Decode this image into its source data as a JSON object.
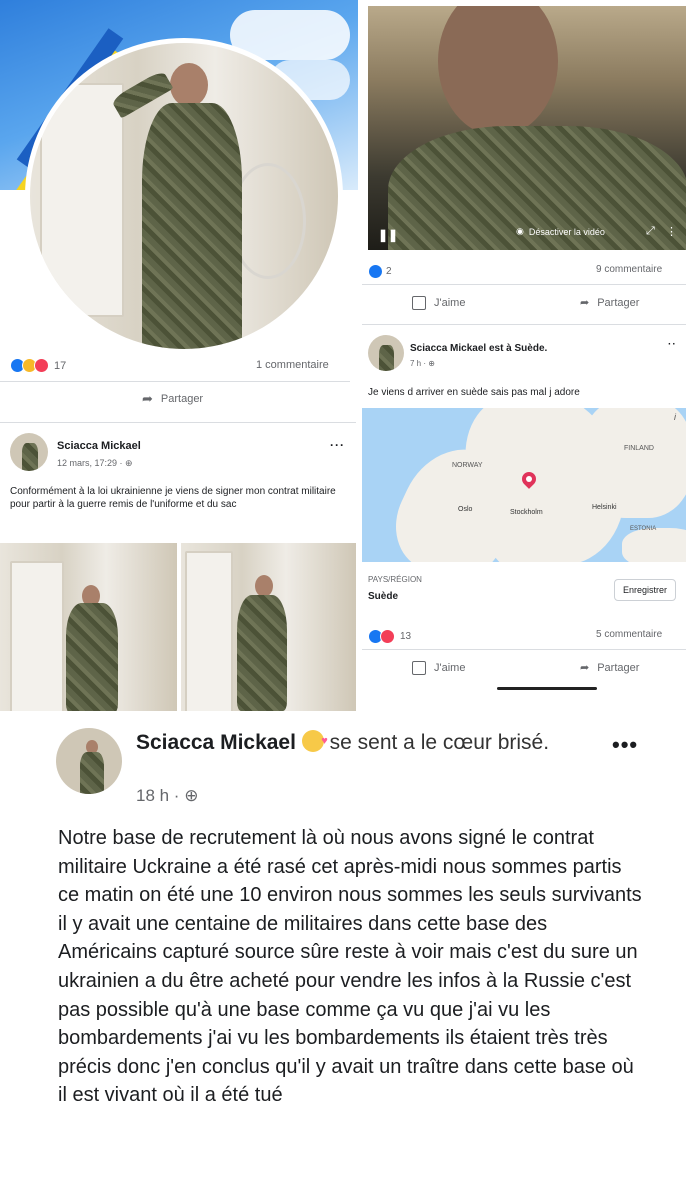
{
  "post_profile": {
    "reactions_count": "17",
    "comments": "1 commentaire",
    "share_label": "Partager"
  },
  "post_video": {
    "reactions_count": "2",
    "comments": "9 commentaire",
    "video_control": "Désactiver la vidéo",
    "like_label": "J'aime",
    "share_label": "Partager"
  },
  "post_contract": {
    "author": "Sciacca Mickael",
    "time": "12 mars, 17:29 · ",
    "text": "Conformément à la loi ukrainienne je viens de signer mon contrat militaire pour partir à la guerre remis de l'uniforme et du sac"
  },
  "post_sweden": {
    "author_line": "Sciacca Mickael est à Suède.",
    "time": "7 h · ",
    "text": "Je viens d arriver en suède sais pas mal j adore",
    "map_labels": [
      "FINLAND",
      "NORWAY",
      "Oslo",
      "Stockholm",
      "Helsinki",
      "ESTONIA"
    ],
    "place_type": "PAYS/RÉGION",
    "place_name": "Suède",
    "save_button": "Enregistrer",
    "reactions_count": "13",
    "comments": "5 commentaire",
    "like_label": "J'aime",
    "share_label": "Partager"
  },
  "post_main": {
    "author": "Sciacca Mickael",
    "feeling": "se sent a le cœur brisé.",
    "time": "18 h · ",
    "text": "Notre base de recrutement là où nous avons signé le contrat militaire Uckraine a été rasé cet après-midi nous sommes partis ce matin on été une 10 environ nous sommes les seuls survivants il y avait une centaine de militaires dans cette base des Américains capturé source sûre reste à voir mais c'est du sure un ukrainien a du être acheté pour vendre les infos à la Russie c'est pas possible qu'à une base comme ça vu que j'ai vu les bombardements j'ai vu les bombardements ils étaient très très précis donc j'en conclus qu'il y avait un traître dans cette base où il est vivant où il a été tué"
  },
  "colors": {
    "facebook_blue": "#1877f2",
    "sky": "#3c8ee8",
    "ukraine_yellow": "#f5d321",
    "map_water": "#a9d3f5",
    "map_land": "#f2efe9",
    "pin": "#e0335a"
  }
}
